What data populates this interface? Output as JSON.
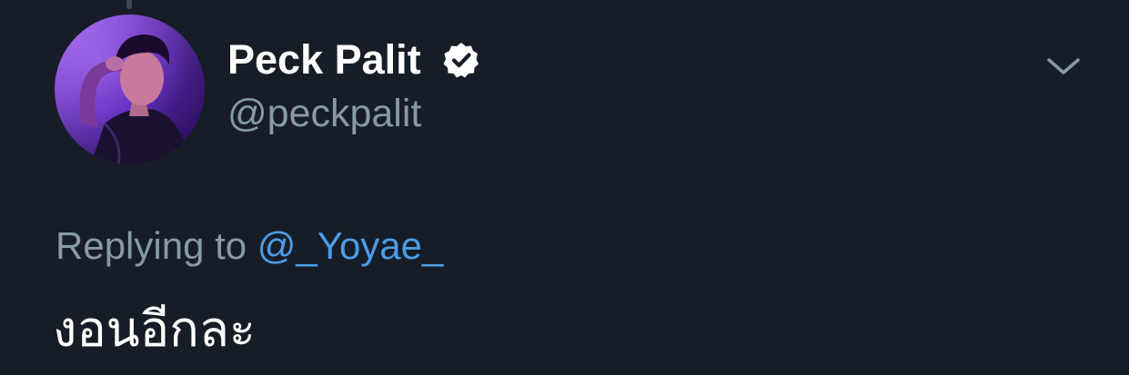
{
  "tweet": {
    "author": {
      "display_name": "Peck Palit",
      "handle": "@peckpalit",
      "verified": true,
      "avatar": "profile-photo"
    },
    "reply_context": {
      "prefix": "Replying to",
      "mention": "@_Yoyae_"
    },
    "text": "งอนอีกละ",
    "menu_icon": "chevron-down-icon"
  },
  "colors": {
    "background": "#161d27",
    "primary_text": "#ffffff",
    "secondary_text": "#8899a6",
    "link": "#4b9de8"
  }
}
